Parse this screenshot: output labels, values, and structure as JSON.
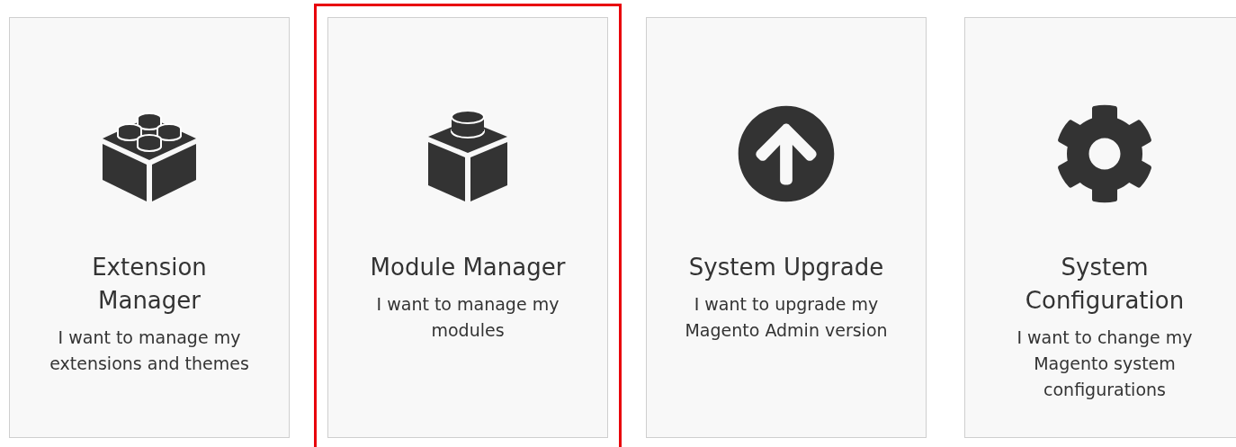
{
  "cards": [
    {
      "kind": "bricks",
      "title": "Extension Manager",
      "description": "I want to manage my extensions and themes",
      "selected": false
    },
    {
      "kind": "brick",
      "title": "Module Manager",
      "description": "I want to manage my modules",
      "selected": true
    },
    {
      "kind": "upgrade",
      "title": "System Upgrade",
      "description": "I want to upgrade my Magento Admin version",
      "selected": false
    },
    {
      "kind": "settings",
      "title": "System Configuration",
      "description": "I want to change my Magento system configurations",
      "selected": false
    }
  ]
}
